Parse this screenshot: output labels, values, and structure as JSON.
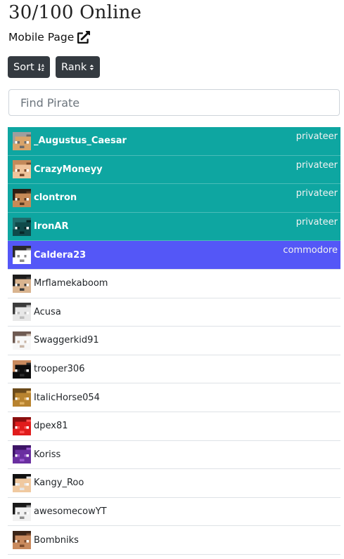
{
  "header": {
    "title": "30/100 Online",
    "mobile_link": "Mobile Page",
    "mobile_icon": "external-link-icon"
  },
  "toolbar": {
    "sort_label": "Sort",
    "sort_icon": "sort-alpha-down-icon",
    "rank_label": "Rank",
    "rank_icon": "sort-caret-icon"
  },
  "search": {
    "placeholder": "Find Pirate",
    "value": ""
  },
  "colors": {
    "privateer": "#0ea6a1",
    "commodore": "#5457f7",
    "button": "#343a40"
  },
  "players": [
    {
      "name": "_Augustus_Caesar",
      "rank": "privateer",
      "skin": [
        "#d9a46a",
        "#9e9e9e",
        "#6b6b6b"
      ]
    },
    {
      "name": "CrazyMoneyy",
      "rank": "privateer",
      "skin": [
        "#f0c49b",
        "#c48a5a",
        "#7a4a2c"
      ]
    },
    {
      "name": "clontron",
      "rank": "privateer",
      "skin": [
        "#c78a57",
        "#2e1f14",
        "#5a3a22"
      ]
    },
    {
      "name": "IronAR",
      "rank": "privateer",
      "skin": [
        "#0f4a4a",
        "#1f6b6b",
        "#072828"
      ]
    },
    {
      "name": "Caldera23",
      "rank": "commodore",
      "skin": [
        "#ffffff",
        "#2a2a2a",
        "#8a8a8a"
      ]
    },
    {
      "name": "Mrflamekaboom",
      "rank": "",
      "skin": [
        "#d9b48f",
        "#1c1c1c",
        "#3a3a3a"
      ]
    },
    {
      "name": "Acusa",
      "rank": "",
      "skin": [
        "#e8e8e8",
        "#3c3c3c",
        "#bdbdbd"
      ]
    },
    {
      "name": "Swaggerkid91",
      "rank": "",
      "skin": [
        "#f7f7f7",
        "#6e5a52",
        "#c9b7a8"
      ]
    },
    {
      "name": "trooper306",
      "rank": "",
      "skin": [
        "#0d0d0d",
        "#c98a5e",
        "#2a2a2a"
      ]
    },
    {
      "name": "ItalicHorse054",
      "rank": "",
      "skin": [
        "#b8832f",
        "#6b4a1a",
        "#e0b060"
      ]
    },
    {
      "name": "dpex81",
      "rank": "",
      "skin": [
        "#e01c1c",
        "#8a0e0e",
        "#ff5252"
      ]
    },
    {
      "name": "Koriss",
      "rank": "",
      "skin": [
        "#6a2fa0",
        "#3d1466",
        "#9b59d0"
      ]
    },
    {
      "name": "Kangy_Roo",
      "rank": "",
      "skin": [
        "#f0c9a0",
        "#111111",
        "#e6e6e6"
      ]
    },
    {
      "name": "awesomecowYT",
      "rank": "",
      "skin": [
        "#f2f2f2",
        "#1a1a1a",
        "#8f8f8f"
      ]
    },
    {
      "name": "Bombniks",
      "rank": "",
      "skin": [
        "#c98a5e",
        "#3b2416",
        "#7a4a2c"
      ]
    }
  ]
}
